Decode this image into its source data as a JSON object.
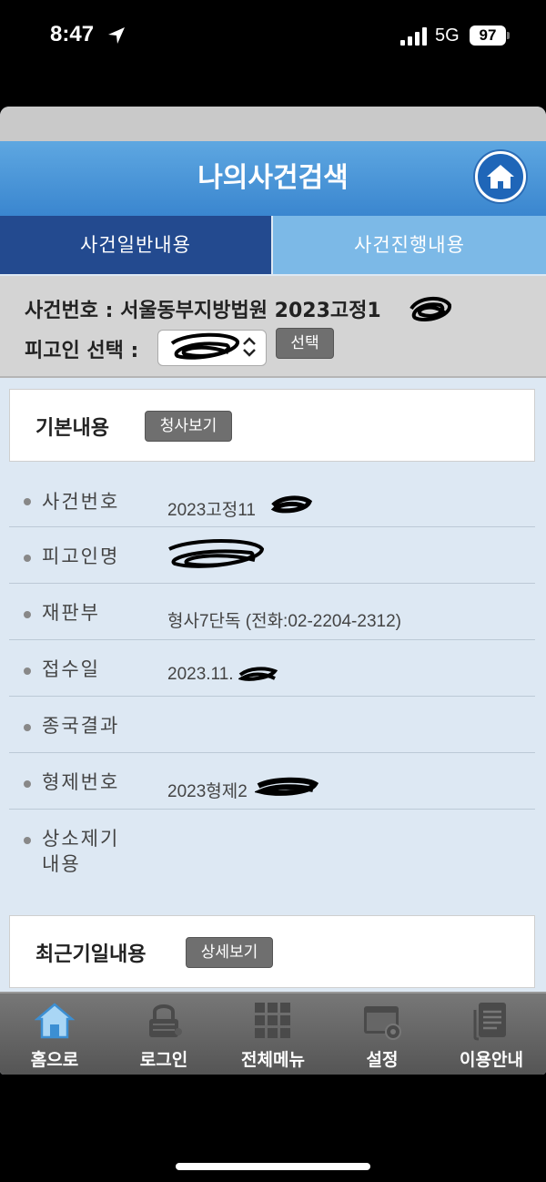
{
  "status": {
    "time": "8:47",
    "network": "5G",
    "battery": "97"
  },
  "header": {
    "title": "나의사건검색"
  },
  "tabs": [
    {
      "label": "사건일반내용"
    },
    {
      "label": "사건진행내용"
    }
  ],
  "case": {
    "number_text": "사건번호 : 서울동부지방법원 2023고정1",
    "defendant_label": "피고인 선택 :",
    "select_value": "",
    "select_button": "선택"
  },
  "basic": {
    "title": "기본내용",
    "button": "청사보기",
    "rows": [
      {
        "label": "사건번호",
        "value": "2023고정11"
      },
      {
        "label": "피고인명",
        "value": ""
      },
      {
        "label": "재판부",
        "value": "형사7단독 (전화:02-2204-2312)"
      },
      {
        "label": "접수일",
        "value": "2023.11."
      },
      {
        "label": "종국결과",
        "value": ""
      },
      {
        "label": "형제번호",
        "value": "2023형제2"
      },
      {
        "label": "상소제기 내용",
        "value": ""
      }
    ]
  },
  "recent": {
    "title": "최근기일내용",
    "button": "상세보기"
  },
  "nav": [
    {
      "label": "홈으로",
      "icon": "home-icon"
    },
    {
      "label": "로그인",
      "icon": "lock-icon"
    },
    {
      "label": "전체메뉴",
      "icon": "grid-menu-icon"
    },
    {
      "label": "설정",
      "icon": "settings-icon"
    },
    {
      "label": "이용안내",
      "icon": "document-icon"
    }
  ],
  "colors": {
    "title_bar": "#3a86cf",
    "tab_active": "#234a8f",
    "tab_inactive": "#7cb9e7",
    "content_bg": "#dde8f3"
  }
}
